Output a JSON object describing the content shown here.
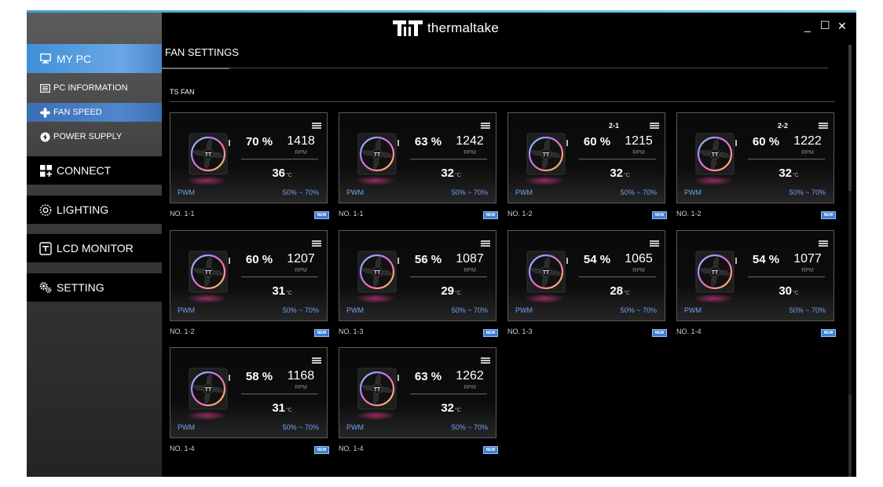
{
  "app": {
    "brand": "thermaltake",
    "window_controls": {
      "minimize": "_",
      "maximize": "☐",
      "close": "✕"
    }
  },
  "sidebar": {
    "items": [
      {
        "label": "MY PC",
        "icon": "monitor-icon",
        "active": true
      },
      {
        "label": "PC INFORMATION",
        "icon": "info-list-icon",
        "sub": true
      },
      {
        "label": "FAN SPEED",
        "icon": "fan-icon",
        "sub": true,
        "active": true
      },
      {
        "label": "POWER SUPPLY",
        "icon": "power-icon",
        "sub": true
      },
      {
        "label": "CONNECT",
        "icon": "connect-icon"
      },
      {
        "label": "LIGHTING",
        "icon": "lighting-icon"
      },
      {
        "label": "LCD MONITOR",
        "icon": "lcd-icon"
      },
      {
        "label": "SETTING",
        "icon": "gear-icon"
      }
    ]
  },
  "main": {
    "title": "FAN SETTINGS",
    "section": "TS FAN",
    "new_badge": "NEW",
    "fans": [
      {
        "percent": "70 %",
        "rpm": "1418",
        "rpm_unit": "RPM",
        "temp": "36",
        "temp_unit": "°C",
        "mode": "PWM",
        "range": "50% ~ 70%",
        "label": "NO. 1-1",
        "group": ""
      },
      {
        "percent": "63 %",
        "rpm": "1242",
        "rpm_unit": "RPM",
        "temp": "32",
        "temp_unit": "°C",
        "mode": "PWM",
        "range": "50% ~ 70%",
        "label": "NO. 1-1",
        "group": ""
      },
      {
        "percent": "60 %",
        "rpm": "1215",
        "rpm_unit": "RPM",
        "temp": "32",
        "temp_unit": "°C",
        "mode": "PWM",
        "range": "50% ~ 70%",
        "label": "NO. 1-2",
        "group": "2-1"
      },
      {
        "percent": "60 %",
        "rpm": "1222",
        "rpm_unit": "RPM",
        "temp": "32",
        "temp_unit": "°C",
        "mode": "PWM",
        "range": "50% ~ 70%",
        "label": "NO. 1-2",
        "group": "2-2"
      },
      {
        "percent": "60 %",
        "rpm": "1207",
        "rpm_unit": "RPM",
        "temp": "31",
        "temp_unit": "°C",
        "mode": "PWM",
        "range": "50% ~ 70%",
        "label": "NO. 1-2",
        "group": ""
      },
      {
        "percent": "56 %",
        "rpm": "1087",
        "rpm_unit": "RPM",
        "temp": "29",
        "temp_unit": "°C",
        "mode": "PWM",
        "range": "50% ~ 70%",
        "label": "NO. 1-3",
        "group": ""
      },
      {
        "percent": "54 %",
        "rpm": "1065",
        "rpm_unit": "RPM",
        "temp": "28",
        "temp_unit": "°C",
        "mode": "PWM",
        "range": "50% ~ 70%",
        "label": "NO. 1-3",
        "group": ""
      },
      {
        "percent": "54 %",
        "rpm": "1077",
        "rpm_unit": "RPM",
        "temp": "30",
        "temp_unit": "°C",
        "mode": "PWM",
        "range": "50% ~ 70%",
        "label": "NO. 1-4",
        "group": ""
      },
      {
        "percent": "58 %",
        "rpm": "1168",
        "rpm_unit": "RPM",
        "temp": "31",
        "temp_unit": "°C",
        "mode": "PWM",
        "range": "50% ~ 70%",
        "label": "NO. 1-4",
        "group": ""
      },
      {
        "percent": "63 %",
        "rpm": "1262",
        "rpm_unit": "RPM",
        "temp": "32",
        "temp_unit": "°C",
        "mode": "PWM",
        "range": "50% ~ 70%",
        "label": "NO. 1-4",
        "group": ""
      }
    ]
  },
  "colors": {
    "accent": "#3f8fd8",
    "link": "#6fa3ef",
    "badge": "#3d7ed6"
  }
}
